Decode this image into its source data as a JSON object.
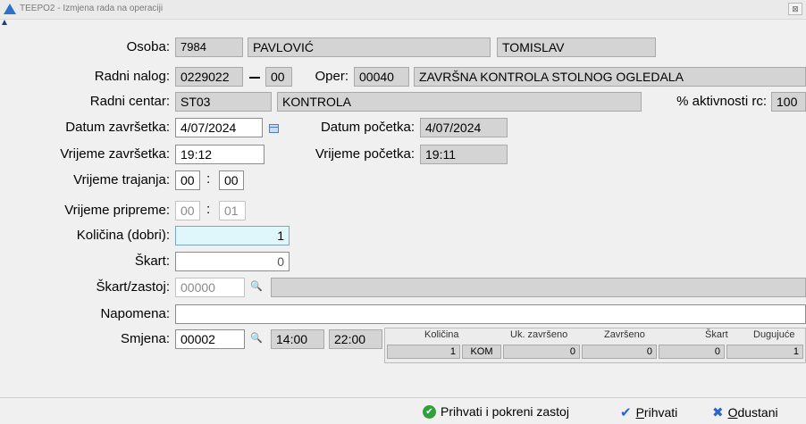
{
  "window": {
    "title": "TEEPO2 - Izmjena rada na operaciji",
    "close_label": "⊠"
  },
  "labels": {
    "osoba": "Osoba:",
    "radni_nalog": "Radni nalog:",
    "oper": "Oper:",
    "radni_centar": "Radni centar:",
    "aktivnost": "% aktivnosti rc:",
    "datum_zavrsetka": "Datum završetka:",
    "datum_pocetka": "Datum početka:",
    "vrijeme_zavrsetka": "Vrijeme završetka:",
    "vrijeme_pocetka": "Vrijeme početka:",
    "vrijeme_trajanja": "Vrijeme trajanja:",
    "vrijeme_pripreme": "Vrijeme pripreme:",
    "kolicina_dobri": "Količina (dobri):",
    "skart": "Škart:",
    "skart_zastoj": "Škart/zastoj:",
    "napomena": "Napomena:",
    "smjena": "Smjena:"
  },
  "fields": {
    "osoba_id": "7984",
    "prezime": "PAVLOVIĆ",
    "ime": "TOMISLAV",
    "nalog": "0229022",
    "nalog_sub": "00",
    "oper_code": "00040",
    "oper_name": "ZAVRŠNA KONTROLA STOLNOG OGLEDALA",
    "rc_code": "ST03",
    "rc_name": "KONTROLA",
    "aktivnost": "100",
    "datum_zavrsetka": "4/07/2024",
    "datum_pocetka": "4/07/2024",
    "vrijeme_zavrsetka": "19:12",
    "vrijeme_pocetka": "19:11",
    "trajanje_h": "00",
    "trajanje_m": "00",
    "priprema_h": "00",
    "priprema_m": "01",
    "kolicina": "1",
    "skart": "0",
    "skart_zastoj_code": "00000",
    "skart_zastoj_desc": "",
    "napomena": "",
    "smjena": "00002",
    "smjena_od": "14:00",
    "smjena_do": "22:00",
    "colon": ":"
  },
  "summary": {
    "headers": [
      "Količina",
      "Uk. završeno",
      "Završeno",
      "Škart",
      "Dugujuće"
    ],
    "kolicina": "1",
    "jedinica": "KOM",
    "uk_zavrseno": "0",
    "zavrseno": "0",
    "skart": "0",
    "dugujuce": "1"
  },
  "buttons": {
    "prihvati_zastoj": "Prihvati i pokreni zastoj",
    "prihvati": "Prihvati",
    "odustani": "Odustani"
  },
  "icons": {
    "search": "🔍",
    "check_circle": "✔",
    "check": "✔",
    "x": "✖"
  }
}
